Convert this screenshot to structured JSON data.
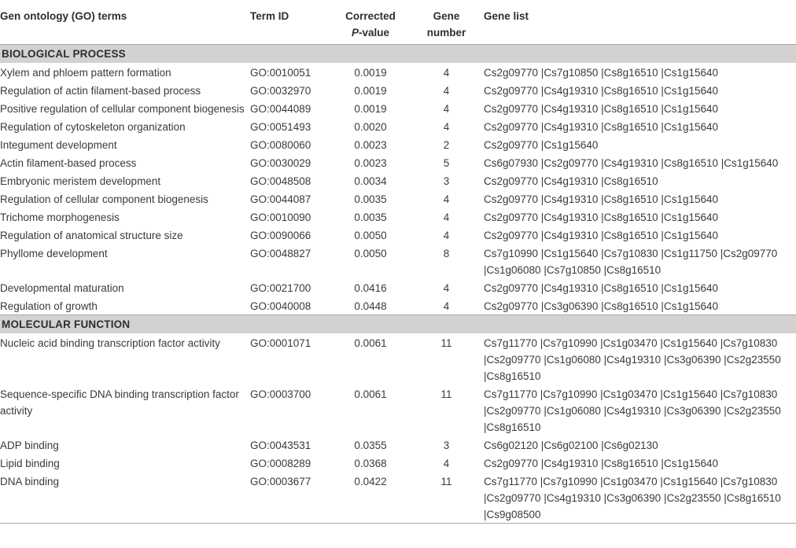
{
  "header": {
    "term": "Gen ontology (GO) terms",
    "id": "Term ID",
    "p_line1": "Corrected",
    "p_italic": "P",
    "p_line2_rest": "-value",
    "gene_line1": "Gene",
    "gene_line2": "number",
    "gene_list": "Gene list"
  },
  "sections": [
    {
      "title": "BIOLOGICAL PROCESS",
      "rows": [
        {
          "term": "Xylem and phloem pattern formation",
          "id": "GO:0010051",
          "p": "0.0019",
          "n": "4",
          "genes": "Cs2g09770 |Cs7g10850 |Cs8g16510 |Cs1g15640"
        },
        {
          "term": "Regulation of actin filament-based process",
          "id": "GO:0032970",
          "p": "0.0019",
          "n": "4",
          "genes": "Cs2g09770 |Cs4g19310 |Cs8g16510 |Cs1g15640"
        },
        {
          "term": "Positive regulation of cellular component biogenesis",
          "id": "GO:0044089",
          "p": "0.0019",
          "n": "4",
          "genes": "Cs2g09770 |Cs4g19310 |Cs8g16510 |Cs1g15640"
        },
        {
          "term": "Regulation of cytoskeleton organization",
          "id": "GO:0051493",
          "p": "0.0020",
          "n": "4",
          "genes": "Cs2g09770 |Cs4g19310 |Cs8g16510 |Cs1g15640"
        },
        {
          "term": "Integument development",
          "id": "GO:0080060",
          "p": "0.0023",
          "n": "2",
          "genes": "Cs2g09770 |Cs1g15640"
        },
        {
          "term": "Actin filament-based process",
          "id": "GO:0030029",
          "p": "0.0023",
          "n": "5",
          "genes": "Cs6g07930 |Cs2g09770 |Cs4g19310 |Cs8g16510 |Cs1g15640"
        },
        {
          "term": "Embryonic meristem development",
          "id": "GO:0048508",
          "p": "0.0034",
          "n": "3",
          "genes": "Cs2g09770 |Cs4g19310 |Cs8g16510"
        },
        {
          "term": "Regulation of cellular component biogenesis",
          "id": "GO:0044087",
          "p": "0.0035",
          "n": "4",
          "genes": "Cs2g09770 |Cs4g19310 |Cs8g16510 |Cs1g15640"
        },
        {
          "term": "Trichome morphogenesis",
          "id": "GO:0010090",
          "p": "0.0035",
          "n": "4",
          "genes": "Cs2g09770 |Cs4g19310 |Cs8g16510 |Cs1g15640"
        },
        {
          "term": "Regulation of anatomical structure size",
          "id": "GO:0090066",
          "p": "0.0050",
          "n": "4",
          "genes": "Cs2g09770 |Cs4g19310 |Cs8g16510 |Cs1g15640"
        },
        {
          "term": "Phyllome development",
          "id": "GO:0048827",
          "p": "0.0050",
          "n": "8",
          "genes": "Cs7g10990 |Cs1g15640 |Cs7g10830 |Cs1g11750 |Cs2g09770 |Cs1g06080 |Cs7g10850 |Cs8g16510"
        },
        {
          "term": "Developmental maturation",
          "id": "GO:0021700",
          "p": "0.0416",
          "n": "4",
          "genes": "Cs2g09770 |Cs4g19310 |Cs8g16510 |Cs1g15640"
        },
        {
          "term": "Regulation of growth",
          "id": "GO:0040008",
          "p": "0.0448",
          "n": "4",
          "genes": "Cs2g09770 |Cs3g06390 |Cs8g16510 |Cs1g15640"
        }
      ]
    },
    {
      "title": "MOLECULAR FUNCTION",
      "rows": [
        {
          "term": "Nucleic acid binding transcription factor activity",
          "id": "GO:0001071",
          "p": "0.0061",
          "n": "11",
          "genes": "Cs7g11770 |Cs7g10990 |Cs1g03470 |Cs1g15640 |Cs7g10830 |Cs2g09770 |Cs1g06080 |Cs4g19310 |Cs3g06390 |Cs2g23550 |Cs8g16510"
        },
        {
          "term": "Sequence-specific DNA binding transcription factor activity",
          "id": "GO:0003700",
          "p": "0.0061",
          "n": "11",
          "genes": "Cs7g11770 |Cs7g10990 |Cs1g03470 |Cs1g15640 |Cs7g10830 |Cs2g09770 |Cs1g06080 |Cs4g19310 |Cs3g06390 |Cs2g23550 |Cs8g16510"
        },
        {
          "term": "ADP binding",
          "id": "GO:0043531",
          "p": "0.0355",
          "n": "3",
          "genes": "Cs6g02120 |Cs6g02100 |Cs6g02130"
        },
        {
          "term": "Lipid binding",
          "id": "GO:0008289",
          "p": "0.0368",
          "n": "4",
          "genes": "Cs2g09770 |Cs4g19310 |Cs8g16510 |Cs1g15640"
        },
        {
          "term": "DNA binding",
          "id": "GO:0003677",
          "p": "0.0422",
          "n": "11",
          "genes": "Cs7g11770 |Cs7g10990 |Cs1g03470 |Cs1g15640 |Cs7g10830 |Cs2g09770 |Cs4g19310 |Cs3g06390 |Cs2g23550 |Cs8g16510 |Cs9g08500"
        }
      ]
    }
  ]
}
